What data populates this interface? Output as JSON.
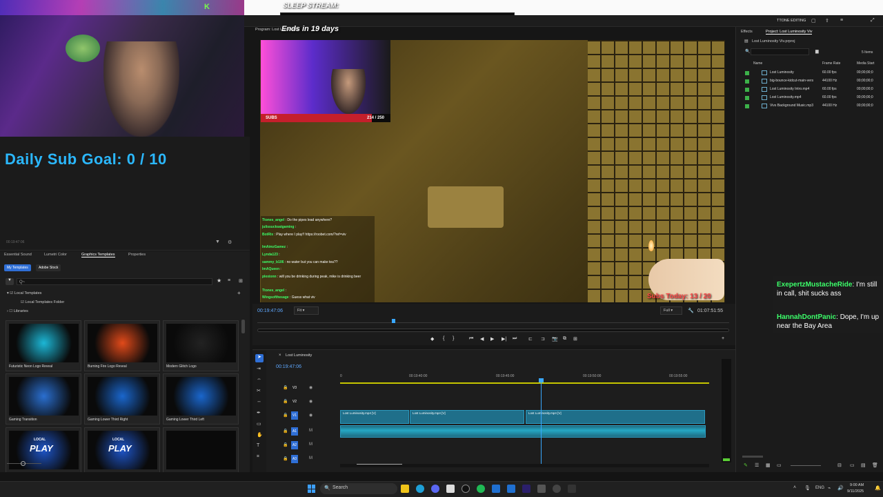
{
  "overlay": {
    "stream_title": "SLEEP STREAM:",
    "ends_text": "Ends in 19 days",
    "daily_goal": "Daily Sub Goal:  0 / 10",
    "cam_badge": "K",
    "subs_label": "SUBS",
    "subs_count": "214 / 250",
    "subs_progress": 0.856,
    "subs_today": "Subs Today: 13 / 20"
  },
  "editor": {
    "workspace_label": "TTONE EDITING",
    "program_label": "Program: Lost Luminosity",
    "timecode": "00:19:47:06",
    "fit_option": "Fit",
    "full_option": "Full",
    "duration": "01:07:51:55",
    "left_timecode": "00:19:47:06"
  },
  "left_tabs": [
    "Essential Sound",
    "Lumetri Color",
    "Graphics Templates",
    "Properties"
  ],
  "template_chips": [
    "My Templates",
    "Adobe Stock"
  ],
  "template_search_placeholder": "Q~",
  "tree": [
    "Local Templates",
    "Local Templates Folder",
    "Libraries"
  ],
  "templates": [
    {
      "label": "Futuristic Neon Logo Reveal",
      "color": "#1cb7d6"
    },
    {
      "label": "Burning Fire Logo Reveal",
      "color": "#e14a1a"
    },
    {
      "label": "Modern Glitch Logo",
      "color": "#222222"
    },
    {
      "label": "Gaming Transition",
      "color": "#2a6fd0"
    },
    {
      "label": "Gaming Lower Third Right",
      "color": "#1a66cc"
    },
    {
      "label": "Gaming Lower Third Left",
      "color": "#1a66cc"
    },
    {
      "label": "",
      "color": "#1e55c8"
    },
    {
      "label": "",
      "color": "#1e55c8"
    },
    {
      "label": "",
      "color": "#0a0a0a"
    }
  ],
  "template_overlay_words": [
    "LOCAL",
    "PLAY",
    "LOCAL",
    "PLAY"
  ],
  "chat": [
    {
      "user": "Ttones_angel",
      "msg": "Do the pipes lead anywhere?"
    },
    {
      "user": "julissucksatgaming",
      "msg": ""
    },
    {
      "user": "BotRix",
      "msg": "Play where I play!! https://roobet.com/?ref=viv"
    },
    {
      "user": "ImAimzGamez",
      "msg": ""
    },
    {
      "user": "Lynda123",
      "msg": ""
    },
    {
      "user": "sammy_b106",
      "msg": "no water but you can make tea??"
    },
    {
      "user": "ImAQueen",
      "msg": ""
    },
    {
      "user": "plexionn",
      "msg": "will you be drinking during peak, mike is drinking beer"
    },
    {
      "user": "Ttones_angel",
      "msg": ""
    },
    {
      "user": "Wingsofthesage",
      "msg": "Guess what viv"
    }
  ],
  "timeline": {
    "sequence": "Lost Luminosity",
    "ticks": [
      "0",
      "00:19:40:00",
      "00:19:45:00",
      "00:19:50:00",
      "00:19:55:00"
    ],
    "tracks": [
      "V3",
      "V2",
      "V1",
      "A1",
      "A2",
      "A3"
    ],
    "clips": [
      {
        "label": "Lost Luminosity.mp4 [V]"
      },
      {
        "label": "Lost Luminosity.mp4 [V]"
      },
      {
        "label": "Lost Luminosity.mp4 [V]"
      }
    ]
  },
  "right_panel": {
    "tabs": [
      "Effects",
      "Project: Lost Luminosity Viv"
    ],
    "project_file": "Lost Luminosity Viv.prproj",
    "item_count": "5 Items",
    "columns": [
      "Name",
      "Frame Rate",
      "Media Start"
    ],
    "items": [
      {
        "name": "Lost Luminosity",
        "rate": "60.00 fps",
        "start": "00;00;00;0"
      },
      {
        "name": "big-bounce-kidcut-main-vers",
        "rate": "44100 Hz",
        "start": "00;00;00;0"
      },
      {
        "name": "Lost Luminosity Intro.mp4",
        "rate": "60.00 fps",
        "start": "00;00;00;0"
      },
      {
        "name": "Lost Luminosity.mp4",
        "rate": "60.00 fps",
        "start": "00;00;00;0"
      },
      {
        "name": "Vivs Background Music.mp3",
        "rate": "44100 Hz",
        "start": "00;00;00;0"
      }
    ]
  },
  "right_chat": [
    {
      "user": "ExepertzMustacheRide",
      "msg": "I'm still in call, shit sucks ass"
    },
    {
      "user": "HannahDontPanic",
      "msg": "Dope, I'm up near the Bay Area"
    }
  ],
  "taskbar": {
    "search": "Search",
    "lang": "ENG",
    "time": "9:00 AM",
    "date": "9/11/2025"
  }
}
